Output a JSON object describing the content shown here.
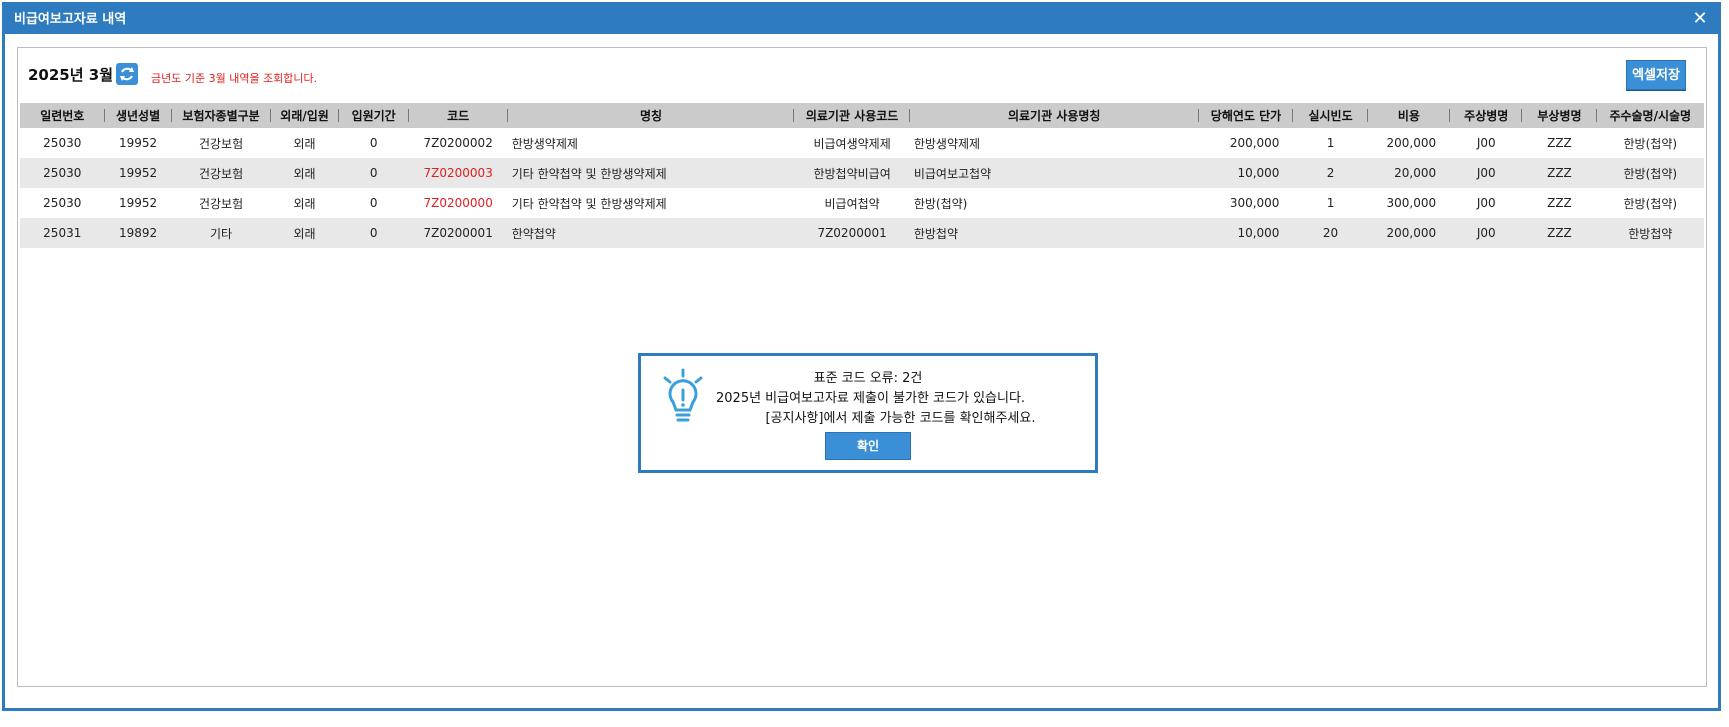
{
  "window": {
    "title": "비급여보고자료 내역",
    "close_glyph": "✕"
  },
  "toolbar": {
    "period": "2025년 3월",
    "notice": "금년도 기준 3월 내역을 조회합니다.",
    "excel_label": "엑셀저장"
  },
  "colors": {
    "accent": "#2f7bbf",
    "button": "#3a8fd6",
    "error_text": "#e02020",
    "header_bg": "#cbcbcb",
    "alt_row_bg": "#e8e8e8"
  },
  "table": {
    "headers": {
      "serial": "일련번호",
      "birth": "생년성별",
      "insurance": "보험자종별구분",
      "visit_type": "외래/입원",
      "stay": "입원기간",
      "code": "코드",
      "name": "명칭",
      "inst_code": "의료기관 사용코드",
      "inst_name": "의료기관 사용명칭",
      "unit_price": "당해연도 단가",
      "frequency": "실시빈도",
      "cost": "비용",
      "main_dx": "주상병명",
      "sub_dx": "부상병명",
      "procedure": "주수술명/시술명"
    },
    "rows": [
      {
        "serial": "25030",
        "birth": "19952",
        "insurance": "건강보험",
        "visit_type": "외래",
        "stay": "0",
        "code": "7Z0200002",
        "code_error": false,
        "name": "한방생약제제",
        "inst_code": "비급여생약제제",
        "inst_name": "한방생약제제",
        "unit_price": "200,000",
        "frequency": "1",
        "cost": "200,000",
        "main_dx": "J00",
        "sub_dx": "ZZZ",
        "procedure": "한방(첩약)"
      },
      {
        "serial": "25030",
        "birth": "19952",
        "insurance": "건강보험",
        "visit_type": "외래",
        "stay": "0",
        "code": "7Z0200003",
        "code_error": true,
        "name": "기타 한약첩약 및 한방생약제제",
        "inst_code": "한방첩약비급여",
        "inst_name": "비급여보고첩약",
        "unit_price": "10,000",
        "frequency": "2",
        "cost": "20,000",
        "main_dx": "J00",
        "sub_dx": "ZZZ",
        "procedure": "한방(첩약)"
      },
      {
        "serial": "25030",
        "birth": "19952",
        "insurance": "건강보험",
        "visit_type": "외래",
        "stay": "0",
        "code": "7Z0200000",
        "code_error": true,
        "name": "기타 한약첩약 및 한방생약제제",
        "inst_code": "비급여첩약",
        "inst_name": "한방(첩약)",
        "unit_price": "300,000",
        "frequency": "1",
        "cost": "300,000",
        "main_dx": "J00",
        "sub_dx": "ZZZ",
        "procedure": "한방(첩약)"
      },
      {
        "serial": "25031",
        "birth": "19892",
        "insurance": "기타",
        "visit_type": "외래",
        "stay": "0",
        "code": "7Z0200001",
        "code_error": false,
        "name": "한약첩약",
        "inst_code": "7Z0200001",
        "inst_name": "한방첩약",
        "unit_price": "10,000",
        "frequency": "20",
        "cost": "200,000",
        "main_dx": "J00",
        "sub_dx": "ZZZ",
        "procedure": "한방첩약"
      }
    ]
  },
  "dialog": {
    "icon": "lightbulb-icon",
    "line1": "표준 코드 오류: 2건",
    "line2": "2025년 비급여보고자료 제출이 불가한 코드가 있습니다.",
    "line3": "[공지사항]에서 제출 가능한 코드를 확인해주세요.",
    "ok_label": "확인"
  }
}
